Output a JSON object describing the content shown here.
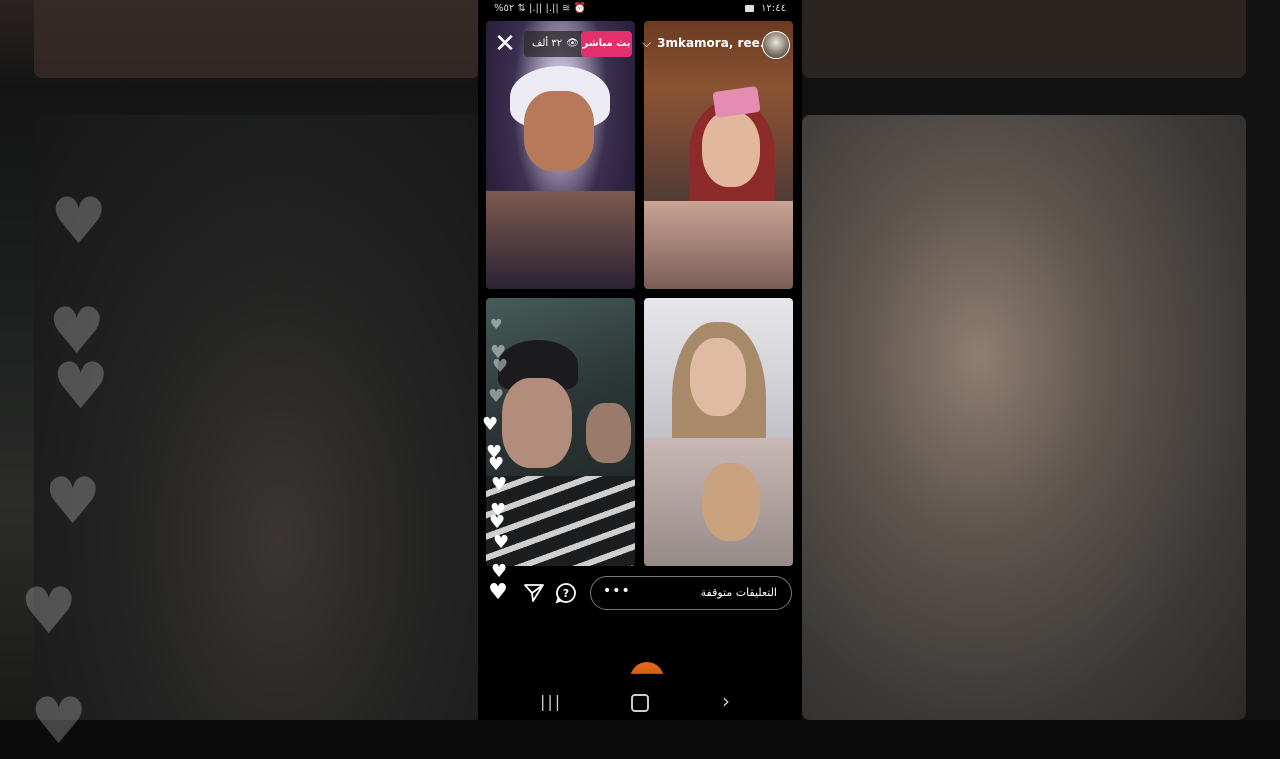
{
  "status_bar": {
    "left_icons": "%٥٢ ⇅ |.|| |.|| ≋ ⏰",
    "time": "١٢:٤٤"
  },
  "live": {
    "badge_label": "بث مباشر",
    "viewer_count": "٣٢ ألف",
    "usernames": "3mkamora, ree..."
  },
  "comments": {
    "placeholder": "التعليقات متوقفة",
    "more_label": "•••"
  },
  "icons": {
    "close": "close-icon",
    "eye": "eye-icon",
    "chevron": "chevron-down-icon",
    "heart": "heart-icon",
    "send": "send-icon",
    "question": "question-icon"
  },
  "navbar": {
    "recent_label": "|||",
    "back_label": "›"
  }
}
